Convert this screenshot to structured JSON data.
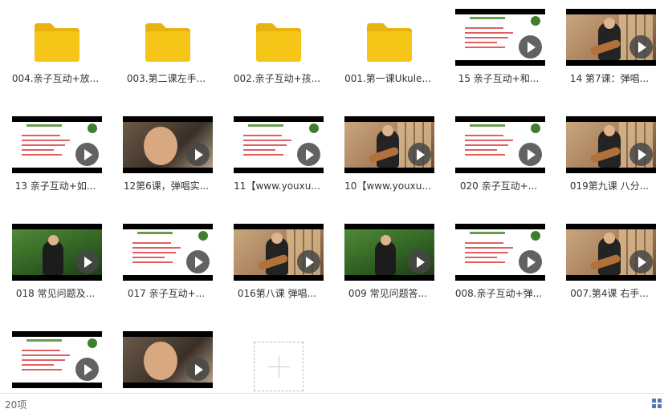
{
  "items": [
    {
      "kind": "folder",
      "label": "004.亲子互动+放..."
    },
    {
      "kind": "folder",
      "label": "003.第二课左手..."
    },
    {
      "kind": "folder",
      "label": "002.亲子互动+孩..."
    },
    {
      "kind": "folder",
      "label": "001.第一课Ukule..."
    },
    {
      "kind": "slide",
      "label": "15  亲子互动+和..."
    },
    {
      "kind": "room",
      "label": "14  第7课：弹唱..."
    },
    {
      "kind": "slide",
      "label": "13  亲子互动+如..."
    },
    {
      "kind": "close",
      "label": "12第6课，弹唱实..."
    },
    {
      "kind": "slide",
      "label": "11【www.youxu..."
    },
    {
      "kind": "room",
      "label": "10【www.youxu..."
    },
    {
      "kind": "slide",
      "label": "020 亲子互动+..."
    },
    {
      "kind": "room",
      "label": "019第九课 八分..."
    },
    {
      "kind": "green",
      "label": "018 常见问题及..."
    },
    {
      "kind": "slide",
      "label": "017 亲子互动+..."
    },
    {
      "kind": "room",
      "label": "016第八课 弹唱..."
    },
    {
      "kind": "green",
      "label": "009 常见问题答..."
    },
    {
      "kind": "slide",
      "label": "008.亲子互动+弹..."
    },
    {
      "kind": "room",
      "label": "007.第4课 右手..."
    },
    {
      "kind": "slide",
      "label": ""
    },
    {
      "kind": "close",
      "label": ""
    }
  ],
  "status": {
    "count": "20项"
  },
  "colors": {
    "folder": "#F5C518",
    "folder_tab": "#E8B20F",
    "accent": "#4F78B8"
  }
}
